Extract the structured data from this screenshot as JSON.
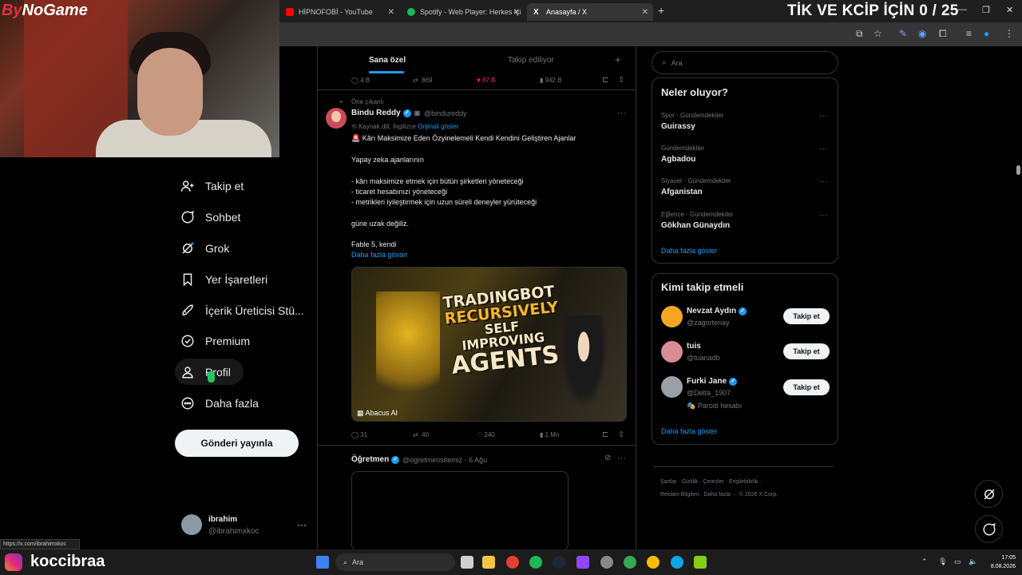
{
  "browser": {
    "tabs": [
      {
        "title": "HİPNOFOBİ - YouTube",
        "color": "#ff0000"
      },
      {
        "title": "Spotify - Web Player: Herkes içi",
        "color": "#1db954"
      },
      {
        "title": "Anasayfa / X",
        "color": "#ffffff"
      }
    ],
    "overlay_counter": "TİK VE KCİP İÇİN 0 / 25",
    "status_url": "https://x.com/ibrahimxkoc"
  },
  "webcam": {
    "logo_prefix": "By",
    "logo_suffix": "NoGame"
  },
  "nav": {
    "items": [
      {
        "label": "Takip et",
        "icon": "person-plus-icon"
      },
      {
        "label": "Sohbet",
        "icon": "chat-icon"
      },
      {
        "label": "Grok",
        "icon": "grok-icon"
      },
      {
        "label": "Yer İşaretleri",
        "icon": "bookmark-icon"
      },
      {
        "label": "İçerik Üreticisi Stü...",
        "icon": "rocket-icon"
      },
      {
        "label": "Premium",
        "icon": "check-circle-icon"
      },
      {
        "label": "Profil",
        "icon": "person-icon"
      },
      {
        "label": "Daha fazla",
        "icon": "more-circle-icon"
      }
    ],
    "post_button": "Gönderi yayınla",
    "account": {
      "name": "ibrahim",
      "handle": "@ibrahimxkoc"
    }
  },
  "timeline": {
    "tab_for_you": "Sana özel",
    "tab_following": "Takip ediliyor",
    "prev_actions": {
      "replies": "4 B",
      "reposts": "869",
      "likes": "87 B",
      "views": "942 B"
    },
    "tweet": {
      "pinned_label": "Öne çıkanlı",
      "author": "Bindu Reddy",
      "handle": "@bindureddy",
      "translation_note": "Kaynak dili: İngilizce",
      "show_original": "Orijinali göster",
      "lines": [
        "🚨 Kârı Maksimize Eden Özyinelemeli Kendi Kendini Geliştiren Ajanlar",
        "Yapay zeka ajanlarının",
        "- kârı maksimize etmek için bütün şirketleri yöneteceği",
        "- ticaret hesabınızı yöneteceği",
        "- metrikleri iyileştirmek için uzun süreli deneyler yürüteceği",
        "güne uzak değiliz.",
        "Fable 5, kendi"
      ],
      "show_more": "Daha fazla göster",
      "image": {
        "title_1": "TRADINGBOT",
        "title_2": "RECURSIVELY",
        "title_3": "SELF IMPROVING",
        "title_4": "AGENTS",
        "watermark": "Abacus AI"
      },
      "actions": {
        "replies": "31",
        "reposts": "40",
        "likes": "240",
        "views": "1 Mn"
      }
    },
    "next_tweet": {
      "author": "Öğretmen",
      "handle": "@ogretmensitemiz",
      "date": "6 Ağu"
    }
  },
  "sidebar": {
    "search_placeholder": "Ara",
    "trends_title": "Neler oluyor?",
    "trends": [
      {
        "category": "Spor · Gündemdekiler",
        "name": "Guirassy"
      },
      {
        "category": "Gündemdekiler",
        "name": "Agbadou"
      },
      {
        "category": "Siyaset · Gündemdekiler",
        "name": "Afganistan"
      },
      {
        "category": "Eğlence · Gündemdekiler",
        "name": "Gökhan Günaydın"
      }
    ],
    "show_more": "Daha fazla göster",
    "wtf_title": "Kimi takip etmeli",
    "who_to_follow": [
      {
        "name": "Nevzat Aydın",
        "handle": "@zagortenay",
        "verified": true,
        "note": "",
        "avatar_color": "#f5a623"
      },
      {
        "name": "tuis",
        "handle": "@tuanadb",
        "verified": false,
        "note": "",
        "avatar_color": "#d88c94"
      },
      {
        "name": "Furki Jane",
        "handle": "@Delta_1907",
        "verified": true,
        "note": "🎭 Parodi hesabı",
        "avatar_color": "#9aa0a6"
      }
    ],
    "follow_label": "Takip et",
    "footer_line1": "Şartlar · Gizlilik · Çerezler · Erişilebilirlik ·",
    "footer_line2": "Reklam Bilgileri · Daha fazla ··· © 2026 X Corp."
  },
  "taskbar": {
    "stream_name": "koccibraa",
    "search_placeholder": "Ara",
    "time": "17:05",
    "date": "8.08.2026"
  }
}
